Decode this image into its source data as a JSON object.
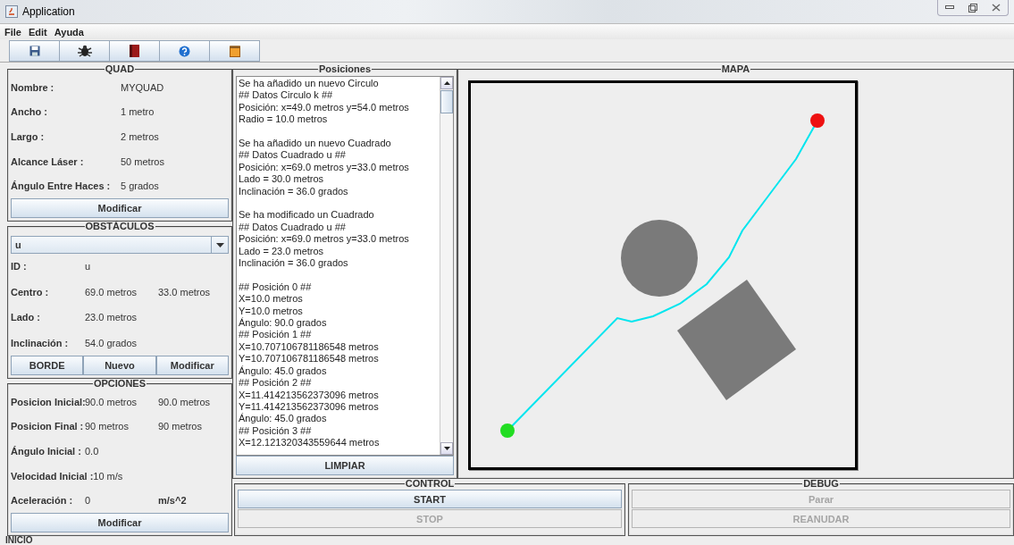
{
  "window": {
    "title": "Application"
  },
  "menu": [
    {
      "label": "File"
    },
    {
      "label": "Edit"
    },
    {
      "label": "Ayuda"
    }
  ],
  "toolbar": [
    {
      "kind": "save"
    },
    {
      "kind": "bug"
    },
    {
      "kind": "book"
    },
    {
      "kind": "help"
    },
    {
      "kind": "note"
    }
  ],
  "quad": {
    "title": "QUAD",
    "rows": [
      {
        "label": "Nombre :",
        "values": [
          "MYQUAD"
        ]
      },
      {
        "label": "Ancho :",
        "values": [
          "1 metro"
        ]
      },
      {
        "label": "Largo :",
        "values": [
          "2 metros"
        ]
      },
      {
        "label": "Alcance Láser :",
        "values": [
          "50 metros"
        ]
      },
      {
        "label": "Ángulo Entre Haces :",
        "values": [
          "5 grados"
        ]
      }
    ],
    "buttons": [
      "Modificar"
    ]
  },
  "obstacles": {
    "title": "OBSTÁCULOS",
    "selector": {
      "value": "u"
    },
    "rows": [
      {
        "label": "ID :",
        "values": [
          "u"
        ]
      },
      {
        "label": "Centro :",
        "values": [
          "69.0 metros",
          "33.0 metros"
        ]
      },
      {
        "label": "Lado :",
        "values": [
          "23.0 metros"
        ]
      },
      {
        "label": "Inclinación :",
        "values": [
          "54.0 grados"
        ]
      }
    ],
    "buttons": [
      "BORDE",
      "Nuevo",
      "Modificar"
    ]
  },
  "options": {
    "title": "OPCIONES",
    "rows": [
      {
        "label": "Posicion Inicial:",
        "values": [
          "90.0 metros",
          "90.0 metros"
        ]
      },
      {
        "label": "Posicion Final :",
        "values": [
          "90 metros",
          "90 metros"
        ]
      },
      {
        "label": "Ángulo Inicial :",
        "values": [
          "0.0"
        ]
      },
      {
        "label": "Velocidad Inicial :",
        "values": [
          "10 m/s"
        ]
      },
      {
        "label": "Aceleración :",
        "values": [
          "0"
        ],
        "unit": "m/s^2"
      }
    ],
    "buttons": [
      "Modificar"
    ]
  },
  "positions": {
    "title": "Posiciones",
    "groups": [
      [
        "Se ha añadido un nuevo Circulo",
        "## Datos Circulo k ##",
        "Posición: x=49.0 metros y=54.0 metros",
        "Radio = 10.0 metros"
      ],
      [
        "Se ha añadido un nuevo Cuadrado",
        "## Datos Cuadrado u ##",
        "Posición: x=69.0 metros y=33.0 metros",
        "Lado = 30.0 metros",
        "Inclinación = 36.0 grados"
      ],
      [
        "Se ha modificado un Cuadrado",
        "## Datos Cuadrado u ##",
        "Posición: x=69.0 metros y=33.0 metros",
        "Lado = 23.0 metros",
        "Inclinación = 36.0 grados"
      ],
      [
        "## Posición 0 ##",
        "X=10.0 metros",
        "Y=10.0 metros",
        "Ángulo: 90.0 grados",
        "## Posición 1 ##",
        "X=10.707106781186548 metros",
        "Y=10.707106781186548 metros",
        "Ángulo: 45.0 grados",
        "## Posición 2 ##",
        "X=11.414213562373096 metros",
        "Y=11.414213562373096 metros",
        "Ángulo: 45.0 grados",
        "## Posición 3 ##",
        "X=12.121320343559644 metros"
      ]
    ],
    "button": "LIMPIAR"
  },
  "map": {
    "title": "MAPA"
  },
  "control": {
    "title": "CONTROL",
    "buttons": [
      {
        "label": "START",
        "disabled": false
      },
      {
        "label": "STOP",
        "disabled": true
      }
    ]
  },
  "debug": {
    "title": "DEBUG",
    "buttons": [
      {
        "label": "Parar",
        "disabled": true
      },
      {
        "label": "REANUDAR",
        "disabled": true
      }
    ]
  },
  "status_bar": {
    "text": "INICIO"
  }
}
